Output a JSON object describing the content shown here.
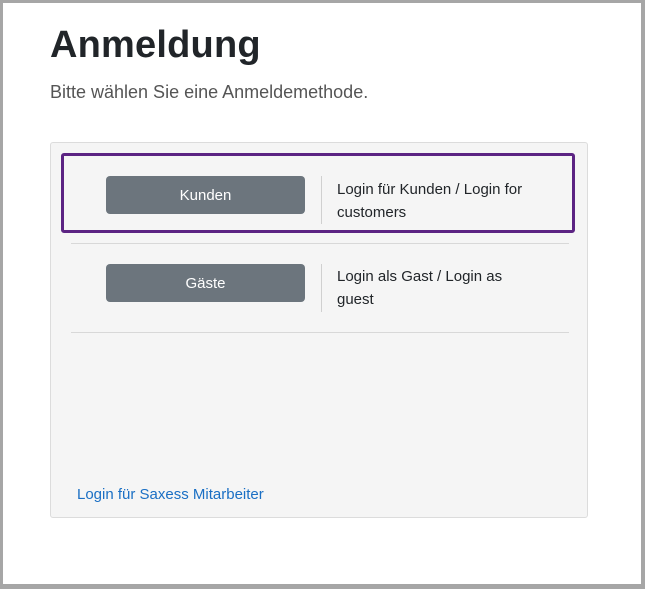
{
  "page": {
    "title": "Anmeldung",
    "subtitle": "Bitte wählen Sie eine Anmeldemethode."
  },
  "options": [
    {
      "button_label": "Kunden",
      "description": "Login für Kunden / Login for customers",
      "selected": true
    },
    {
      "button_label": "Gäste",
      "description": "Login als Gast / Login as guest",
      "selected": false
    }
  ],
  "staff_link": "Login für Saxess Mitarbeiter",
  "colors": {
    "button_bg": "#6c757d",
    "selected_border": "#5c2483",
    "link": "#1a6fc4",
    "card_bg": "#f5f5f5"
  }
}
